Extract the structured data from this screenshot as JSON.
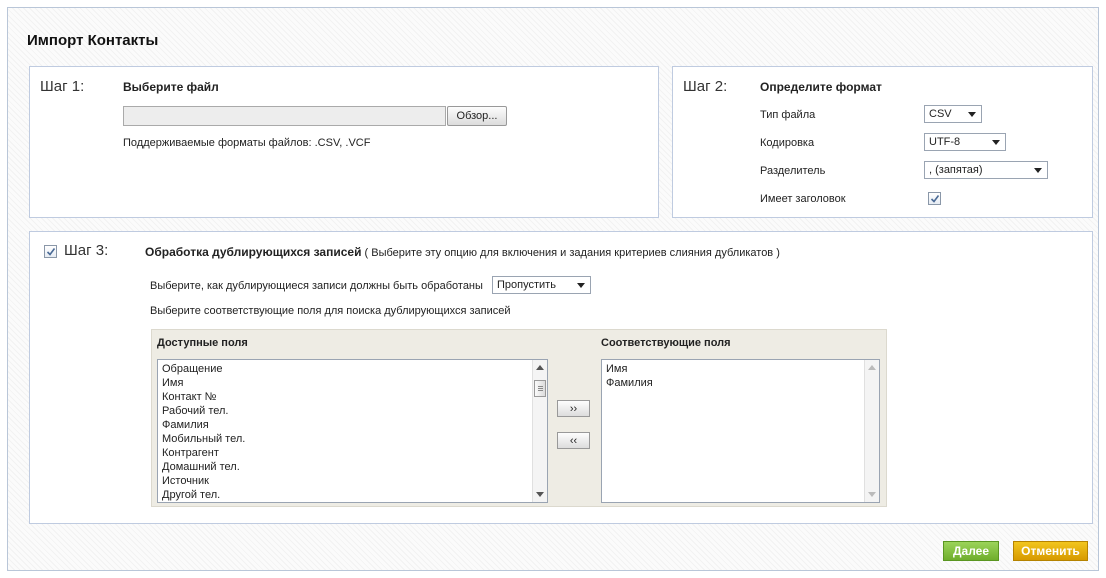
{
  "page": {
    "title": "Импорт Контакты"
  },
  "step1": {
    "label": "Шаг 1:",
    "heading": "Выберите файл",
    "browse_label": "Обзор...",
    "file_value": "",
    "supported_formats": "Поддерживаемые форматы файлов: .CSV, .VCF"
  },
  "step2": {
    "label": "Шаг 2:",
    "heading": "Определите формат",
    "file_type_label": "Тип файла",
    "file_type_value": "CSV",
    "encoding_label": "Кодировка",
    "encoding_value": "UTF-8",
    "delimiter_label": "Разделитель",
    "delimiter_value": ", (запятая)",
    "has_header_label": "Имеет заголовок",
    "has_header_checked": true
  },
  "step3": {
    "enabled": true,
    "label": "Шаг 3:",
    "heading": "Обработка дублирующихся записей",
    "heading_note": " ( Выберите эту опцию для включения и задания критериев слияния дубликатов )",
    "handling_label": "Выберите, как дублирующиеся записи должны быть обработаны",
    "handling_value": "Пропустить",
    "match_fields_label": "Выберите соответствующие поля для поиска дублирующихся записей",
    "available_fields_title": "Доступные поля",
    "matching_fields_title": "Соответствующие поля",
    "available_fields": [
      "Обращение",
      "Имя",
      "Контакт №",
      "Рабочий тел.",
      "Фамилия",
      "Мобильный тел.",
      "Контрагент",
      "Домашний тел.",
      "Источник",
      "Другой тел."
    ],
    "matching_fields": [
      "Имя",
      "Фамилия"
    ],
    "add_label": "››",
    "remove_label": "‹‹"
  },
  "actions": {
    "next_label": "Далее",
    "cancel_label": "Отменить"
  },
  "colors": {
    "next_button": "#7fbd3c",
    "cancel_button": "#e3ad0b",
    "panel_border": "#bfcbe0"
  },
  "icons": {
    "checkbox_mark": "check-icon"
  }
}
